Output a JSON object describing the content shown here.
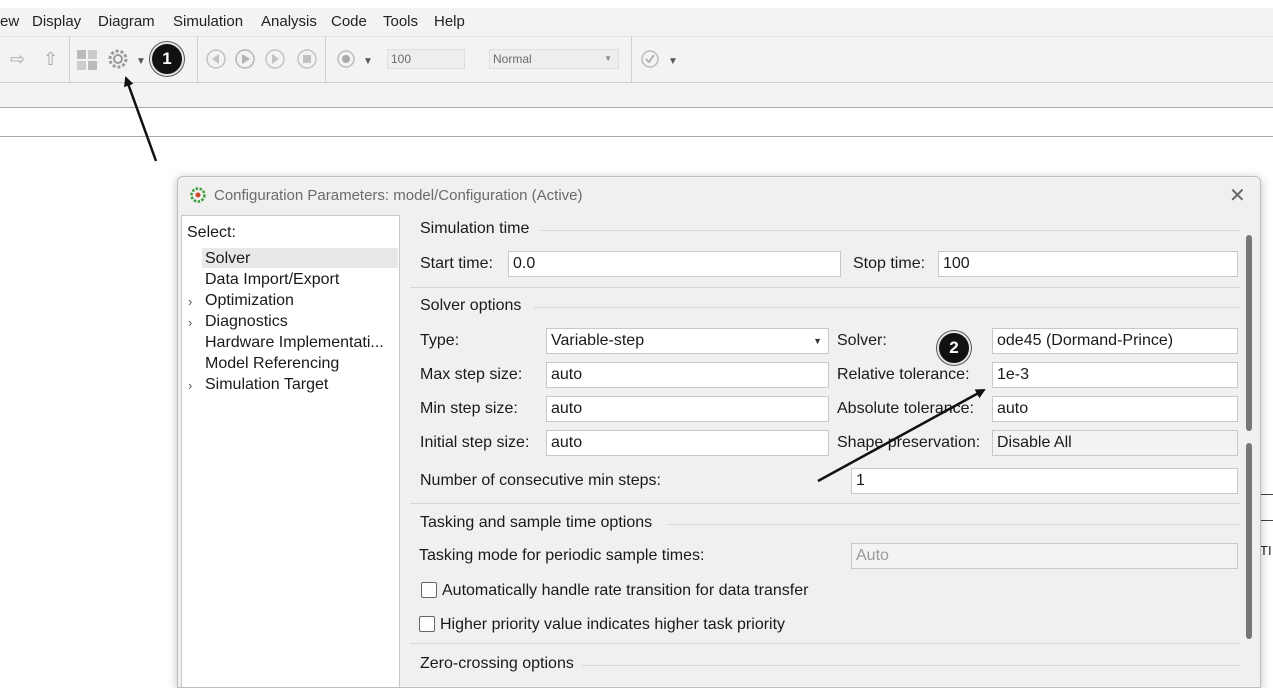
{
  "menubar": {
    "items": [
      "ew",
      "Display",
      "Diagram",
      "Simulation",
      "Analysis",
      "Code",
      "Tools",
      "Help"
    ]
  },
  "toolbar": {
    "stop_time": "100",
    "sim_mode": "Normal"
  },
  "annotations": {
    "badge1": "1",
    "badge2": "2"
  },
  "dialog": {
    "title": "Configuration Parameters: model/Configuration (Active)",
    "select_label": "Select:",
    "nav": [
      {
        "label": "Solver",
        "expandable": false,
        "selected": true
      },
      {
        "label": "Data Import/Export",
        "expandable": false
      },
      {
        "label": "Optimization",
        "expandable": true
      },
      {
        "label": "Diagnostics",
        "expandable": true
      },
      {
        "label": "Hardware Implementati...",
        "expandable": false
      },
      {
        "label": "Model Referencing",
        "expandable": false
      },
      {
        "label": "Simulation Target",
        "expandable": true
      }
    ],
    "sim_time": {
      "group": "Simulation time",
      "start_label": "Start time:",
      "start_value": "0.0",
      "stop_label": "Stop time:",
      "stop_value": "100"
    },
    "solver_options": {
      "group": "Solver options",
      "type_label": "Type:",
      "type_value": "Variable-step",
      "solver_label": "Solver:",
      "solver_value": "ode45 (Dormand-Prince)",
      "max_step_label": "Max step size:",
      "max_step_value": "auto",
      "rel_tol_label": "Relative tolerance:",
      "rel_tol_value": "1e-3",
      "min_step_label": "Min step size:",
      "min_step_value": "auto",
      "abs_tol_label": "Absolute tolerance:",
      "abs_tol_value": "auto",
      "init_step_label": "Initial step size:",
      "init_step_value": "auto",
      "shape_label": "Shape preservation:",
      "shape_value": "Disable All",
      "consec_label": "Number of consecutive min steps:",
      "consec_value": "1"
    },
    "tasking": {
      "group": "Tasking and sample time options",
      "mode_label": "Tasking mode for periodic sample times:",
      "mode_value": "Auto",
      "auto_rate_label": "Automatically handle rate transition for data transfer",
      "priority_label": "Higher priority value indicates higher task priority"
    },
    "zero_crossing": {
      "group": "Zero-crossing options"
    }
  },
  "background_fragment": "TI"
}
